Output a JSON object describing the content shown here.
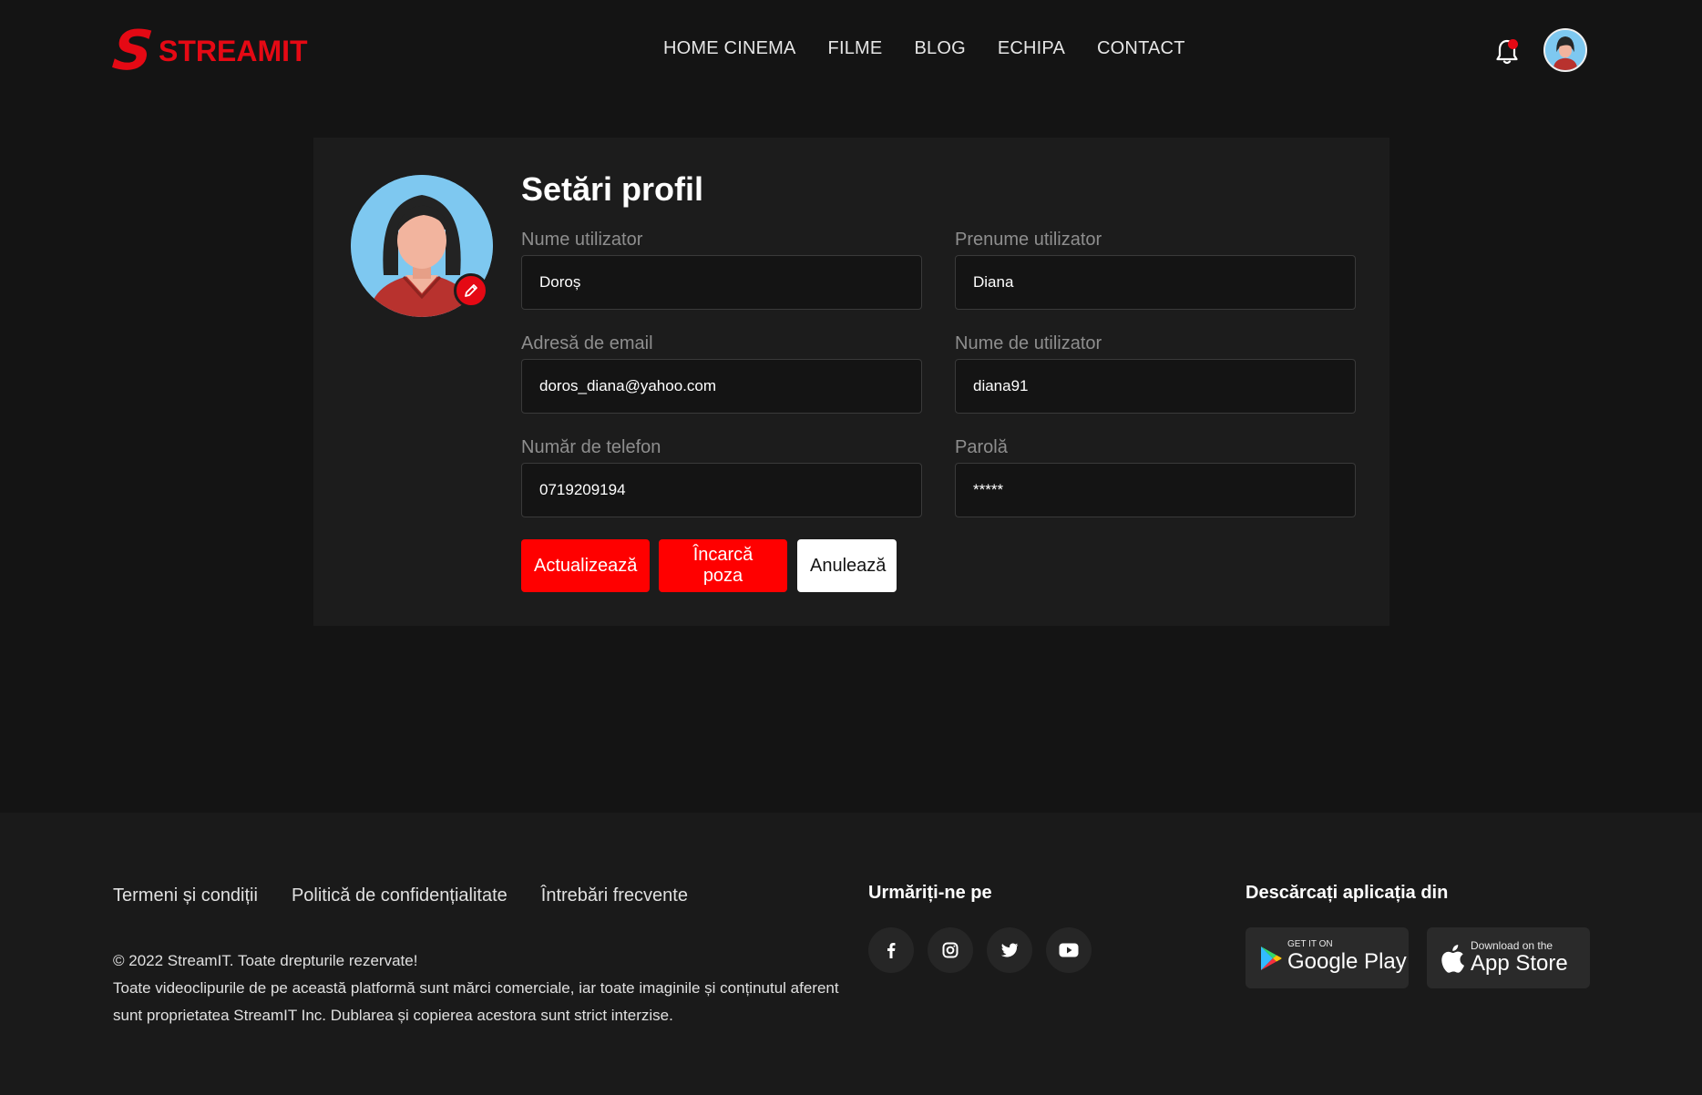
{
  "header": {
    "logo_text": "STREAMIT",
    "logo_mark": "S",
    "nav": [
      "HOME CINEMA",
      "FILME",
      "BLOG",
      "ECHIPA",
      "CONTACT"
    ],
    "bell_icon": "bell-icon",
    "avatar_icon": "user-avatar"
  },
  "profile": {
    "title": "Setări profil",
    "fields": {
      "last_name": {
        "label": "Nume utilizator",
        "value": "Doroș"
      },
      "first_name": {
        "label": "Prenume utilizator",
        "value": "Diana"
      },
      "email": {
        "label": "Adresă de email",
        "value": "doros_diana@yahoo.com"
      },
      "username": {
        "label": "Nume de utilizator",
        "value": "diana91"
      },
      "phone": {
        "label": "Număr de telefon",
        "value": "0719209194"
      },
      "password": {
        "label": "Parolă",
        "value": "*****"
      }
    },
    "buttons": {
      "update": "Actualizează",
      "upload": "Încarcă poza",
      "cancel": "Anulează"
    }
  },
  "footer": {
    "links": [
      "Termeni și condiții",
      "Politică de confidențialitate",
      "Întrebări frecvente"
    ],
    "copyright": "© 2022 StreamIT. Toate drepturile rezervate!",
    "disclaimer": "Toate videoclipurile de pe această platformă sunt mărci comerciale, iar toate imaginile și conținutul aferent sunt proprietatea StreamIT Inc. Dublarea și copierea acestora sunt strict interzise.",
    "follow_heading": "Urmăriți-ne pe",
    "social_icons": [
      "facebook-icon",
      "instagram-icon",
      "twitter-icon",
      "youtube-icon"
    ],
    "download_heading": "Descărcați aplicația din",
    "google_play": {
      "small": "GET IT ON",
      "big": "Google Play"
    },
    "app_store": {
      "small": "Download on the",
      "big": "App Store"
    }
  },
  "colors": {
    "accent": "#e50914",
    "button_red": "#ff0000",
    "background": "#141414",
    "card": "#1c1c1c"
  }
}
